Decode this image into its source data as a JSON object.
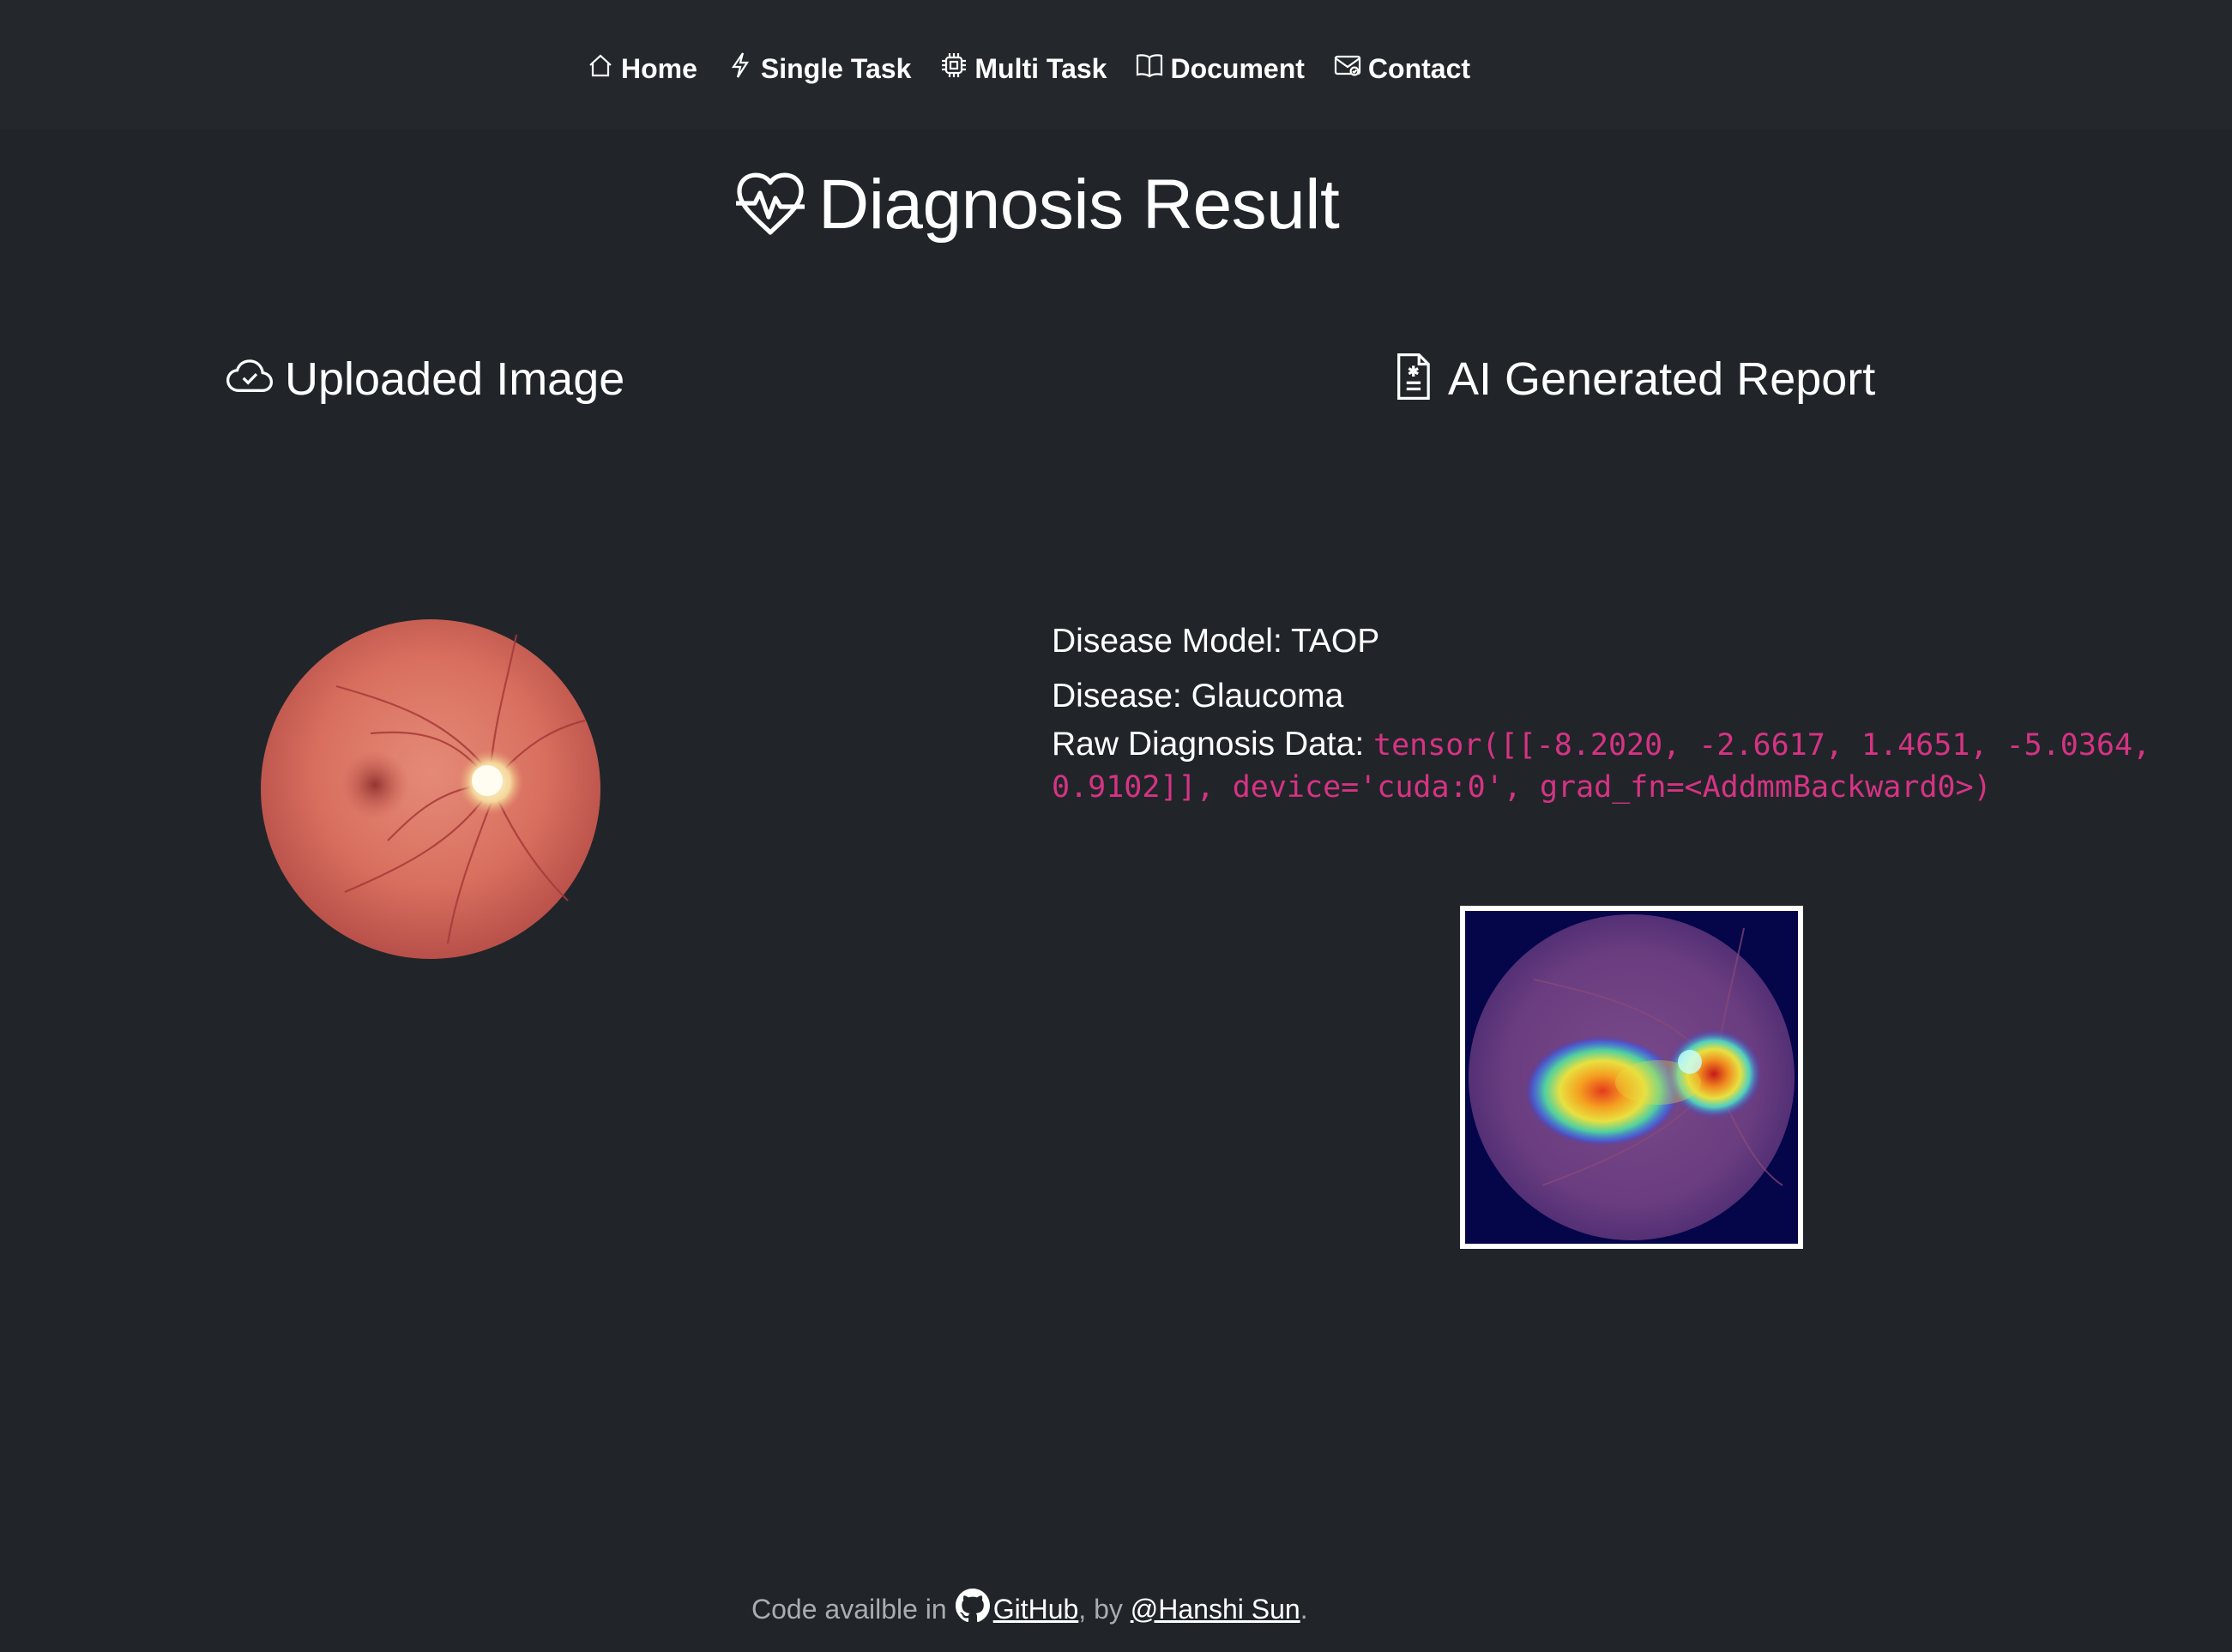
{
  "nav": {
    "items": [
      {
        "label": "Home",
        "icon": "house-icon"
      },
      {
        "label": "Single Task",
        "icon": "lightning-icon"
      },
      {
        "label": "Multi Task",
        "icon": "cpu-icon"
      },
      {
        "label": "Document",
        "icon": "book-icon"
      },
      {
        "label": "Contact",
        "icon": "envelope-icon"
      }
    ]
  },
  "page": {
    "title": "Diagnosis Result",
    "title_icon": "heart-pulse-icon"
  },
  "uploaded": {
    "heading": "Uploaded Image",
    "icon": "cloud-check-icon"
  },
  "report": {
    "heading": "AI Generated Report",
    "icon": "file-medical-icon",
    "model_label": "Disease Model:",
    "model_value": "TAOP",
    "disease_label": "Disease:",
    "disease_value": "Glaucoma",
    "raw_label": "Raw Diagnosis Data:",
    "raw_value": "tensor([[-8.2020, -2.6617, 1.4651, -5.0364, 0.9102]], device='cuda:0', grad_fn=<AddmmBackward0>)"
  },
  "footer": {
    "prefix": "Code availble in",
    "github_label": " GitHub",
    "middle": ", by ",
    "author_label": "@Hanshi Sun",
    "suffix": ".",
    "github_icon": "github-icon"
  },
  "colors": {
    "background": "#212529",
    "code": "#d63384",
    "muted": "#a9adb1"
  }
}
